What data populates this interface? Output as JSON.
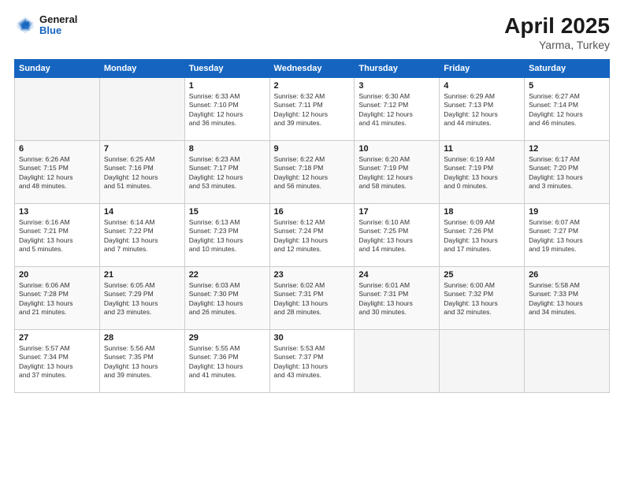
{
  "header": {
    "logo": {
      "general": "General",
      "blue": "Blue"
    },
    "title": "April 2025",
    "location": "Yarma, Turkey"
  },
  "weekdays": [
    "Sunday",
    "Monday",
    "Tuesday",
    "Wednesday",
    "Thursday",
    "Friday",
    "Saturday"
  ],
  "weeks": [
    [
      {
        "day": "",
        "info": ""
      },
      {
        "day": "",
        "info": ""
      },
      {
        "day": "1",
        "info": "Sunrise: 6:33 AM\nSunset: 7:10 PM\nDaylight: 12 hours\nand 36 minutes."
      },
      {
        "day": "2",
        "info": "Sunrise: 6:32 AM\nSunset: 7:11 PM\nDaylight: 12 hours\nand 39 minutes."
      },
      {
        "day": "3",
        "info": "Sunrise: 6:30 AM\nSunset: 7:12 PM\nDaylight: 12 hours\nand 41 minutes."
      },
      {
        "day": "4",
        "info": "Sunrise: 6:29 AM\nSunset: 7:13 PM\nDaylight: 12 hours\nand 44 minutes."
      },
      {
        "day": "5",
        "info": "Sunrise: 6:27 AM\nSunset: 7:14 PM\nDaylight: 12 hours\nand 46 minutes."
      }
    ],
    [
      {
        "day": "6",
        "info": "Sunrise: 6:26 AM\nSunset: 7:15 PM\nDaylight: 12 hours\nand 48 minutes."
      },
      {
        "day": "7",
        "info": "Sunrise: 6:25 AM\nSunset: 7:16 PM\nDaylight: 12 hours\nand 51 minutes."
      },
      {
        "day": "8",
        "info": "Sunrise: 6:23 AM\nSunset: 7:17 PM\nDaylight: 12 hours\nand 53 minutes."
      },
      {
        "day": "9",
        "info": "Sunrise: 6:22 AM\nSunset: 7:18 PM\nDaylight: 12 hours\nand 56 minutes."
      },
      {
        "day": "10",
        "info": "Sunrise: 6:20 AM\nSunset: 7:19 PM\nDaylight: 12 hours\nand 58 minutes."
      },
      {
        "day": "11",
        "info": "Sunrise: 6:19 AM\nSunset: 7:19 PM\nDaylight: 13 hours\nand 0 minutes."
      },
      {
        "day": "12",
        "info": "Sunrise: 6:17 AM\nSunset: 7:20 PM\nDaylight: 13 hours\nand 3 minutes."
      }
    ],
    [
      {
        "day": "13",
        "info": "Sunrise: 6:16 AM\nSunset: 7:21 PM\nDaylight: 13 hours\nand 5 minutes."
      },
      {
        "day": "14",
        "info": "Sunrise: 6:14 AM\nSunset: 7:22 PM\nDaylight: 13 hours\nand 7 minutes."
      },
      {
        "day": "15",
        "info": "Sunrise: 6:13 AM\nSunset: 7:23 PM\nDaylight: 13 hours\nand 10 minutes."
      },
      {
        "day": "16",
        "info": "Sunrise: 6:12 AM\nSunset: 7:24 PM\nDaylight: 13 hours\nand 12 minutes."
      },
      {
        "day": "17",
        "info": "Sunrise: 6:10 AM\nSunset: 7:25 PM\nDaylight: 13 hours\nand 14 minutes."
      },
      {
        "day": "18",
        "info": "Sunrise: 6:09 AM\nSunset: 7:26 PM\nDaylight: 13 hours\nand 17 minutes."
      },
      {
        "day": "19",
        "info": "Sunrise: 6:07 AM\nSunset: 7:27 PM\nDaylight: 13 hours\nand 19 minutes."
      }
    ],
    [
      {
        "day": "20",
        "info": "Sunrise: 6:06 AM\nSunset: 7:28 PM\nDaylight: 13 hours\nand 21 minutes."
      },
      {
        "day": "21",
        "info": "Sunrise: 6:05 AM\nSunset: 7:29 PM\nDaylight: 13 hours\nand 23 minutes."
      },
      {
        "day": "22",
        "info": "Sunrise: 6:03 AM\nSunset: 7:30 PM\nDaylight: 13 hours\nand 26 minutes."
      },
      {
        "day": "23",
        "info": "Sunrise: 6:02 AM\nSunset: 7:31 PM\nDaylight: 13 hours\nand 28 minutes."
      },
      {
        "day": "24",
        "info": "Sunrise: 6:01 AM\nSunset: 7:31 PM\nDaylight: 13 hours\nand 30 minutes."
      },
      {
        "day": "25",
        "info": "Sunrise: 6:00 AM\nSunset: 7:32 PM\nDaylight: 13 hours\nand 32 minutes."
      },
      {
        "day": "26",
        "info": "Sunrise: 5:58 AM\nSunset: 7:33 PM\nDaylight: 13 hours\nand 34 minutes."
      }
    ],
    [
      {
        "day": "27",
        "info": "Sunrise: 5:57 AM\nSunset: 7:34 PM\nDaylight: 13 hours\nand 37 minutes."
      },
      {
        "day": "28",
        "info": "Sunrise: 5:56 AM\nSunset: 7:35 PM\nDaylight: 13 hours\nand 39 minutes."
      },
      {
        "day": "29",
        "info": "Sunrise: 5:55 AM\nSunset: 7:36 PM\nDaylight: 13 hours\nand 41 minutes."
      },
      {
        "day": "30",
        "info": "Sunrise: 5:53 AM\nSunset: 7:37 PM\nDaylight: 13 hours\nand 43 minutes."
      },
      {
        "day": "",
        "info": ""
      },
      {
        "day": "",
        "info": ""
      },
      {
        "day": "",
        "info": ""
      }
    ]
  ]
}
